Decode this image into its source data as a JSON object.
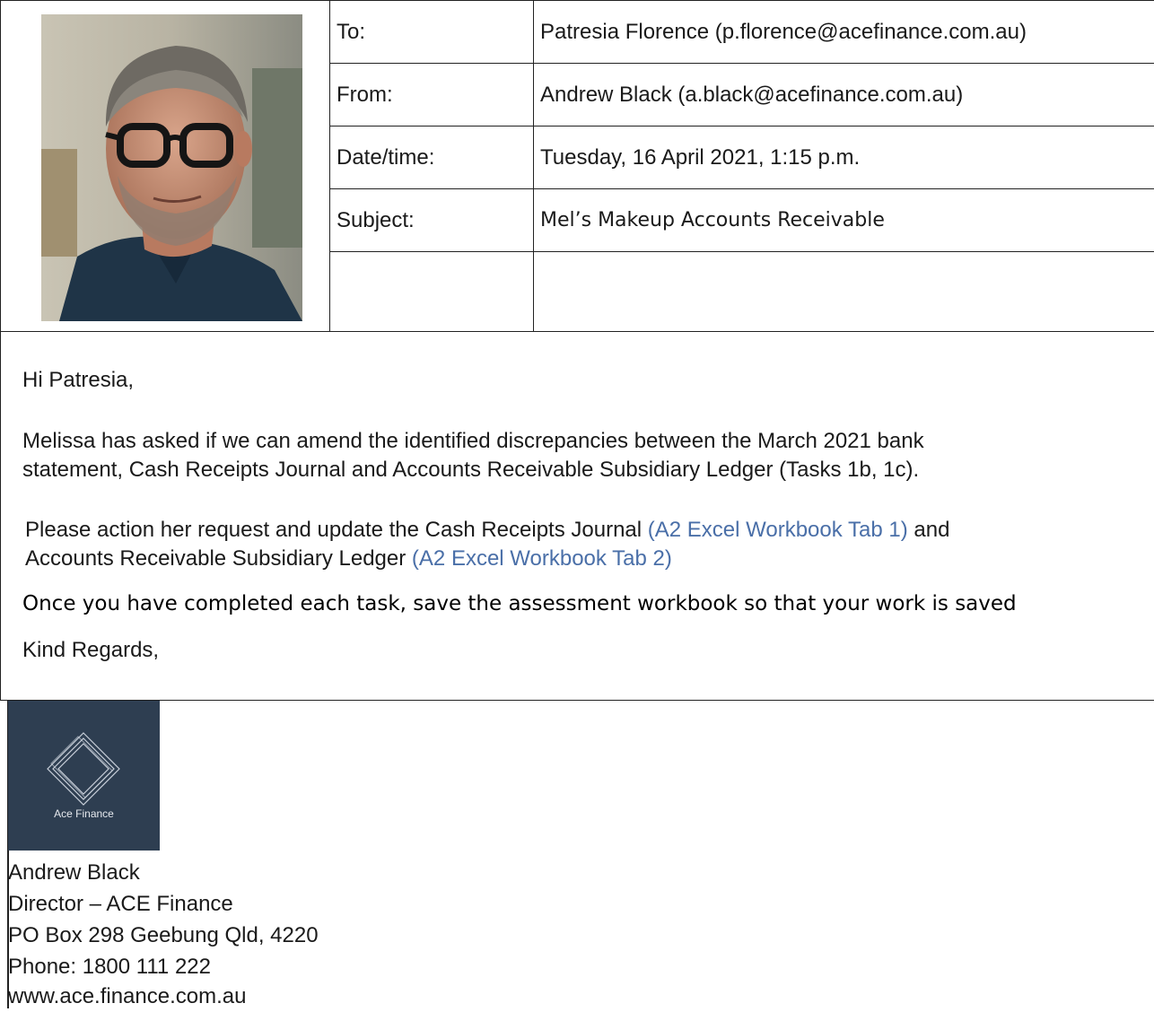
{
  "email": {
    "to_label": "To:",
    "to_value": "Patresia Florence (p.florence@acefinance.com.au)",
    "from_label": "From:",
    "from_value": "Andrew Black (a.black@acefinance.com.au)",
    "datetime_label": "Date/time:",
    "datetime_value": "Tuesday, 16 April 2021, 1:15 p.m.",
    "subject_label": "Subject:",
    "subject_value": "Mel’s Makeup Accounts Receivable"
  },
  "body": {
    "greeting": "Hi Patresia,",
    "para1_line1": "Melissa has asked if we can amend the identified discrepancies between the March 2021 bank",
    "para1_line2": "statement, Cash Receipts Journal and Accounts Receivable Subsidiary Ledger (Tasks 1b, 1c).",
    "para2_line1_text": "Please action her request and update the Cash Receipts Journal ",
    "para2_line1_link": "(A2 Excel Workbook Tab 1)",
    "para2_line1_tail": " and",
    "para2_line2_text": "Accounts Receivable Subsidiary Ledger ",
    "para2_line2_link": "(A2 Excel Workbook Tab 2)",
    "instruction": "Once you have completed each task, save the assessment workbook so that your work is saved",
    "closing": "Kind Regards,"
  },
  "signature": {
    "logo_text": "Ace Finance",
    "name": "Andrew Black",
    "title": "Director – ACE Finance",
    "address": "PO Box 298 Geebung Qld, 4220",
    "phone": "Phone: 1800 111 222",
    "website": "www.ace.finance.com.au"
  },
  "colors": {
    "link": "#4a6fa8",
    "logo_bg": "#2e3e51"
  }
}
